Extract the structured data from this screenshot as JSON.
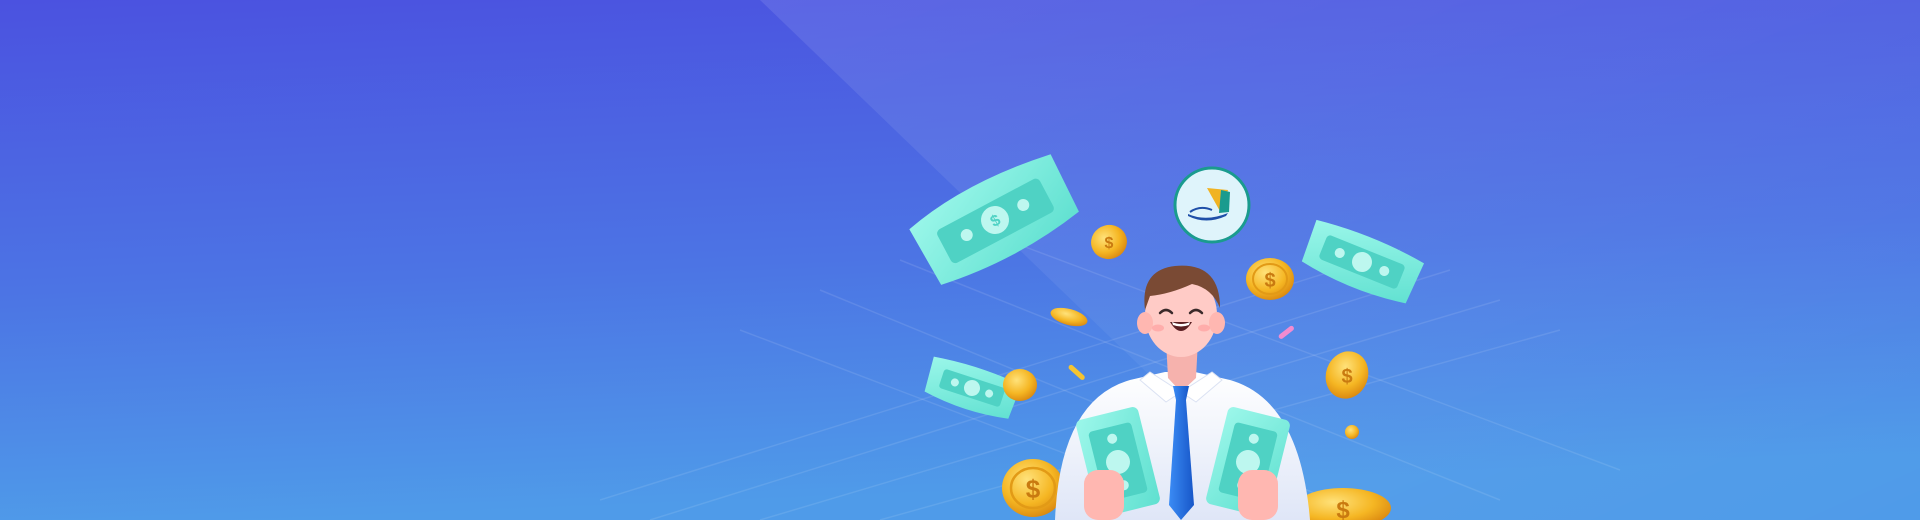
{
  "banner": {
    "gradient_top": "#4a52e0",
    "gradient_bottom": "#4f9ae8",
    "bill_color": "#7ff0e0",
    "bill_inner_color": "#4fd2c4",
    "coin_color": "#f5b623",
    "tie_color": "#1f6fe0",
    "shirt_color": "#f4f7ff",
    "skin_color": "#ffc9c4",
    "hair_color": "#7a4a34"
  },
  "illustration": {
    "character": "smiling-man-with-money",
    "logo_badge": "sailboat-logo-icon",
    "decorations": [
      "banknote-icon",
      "gold-coin-icon",
      "confetti"
    ]
  }
}
